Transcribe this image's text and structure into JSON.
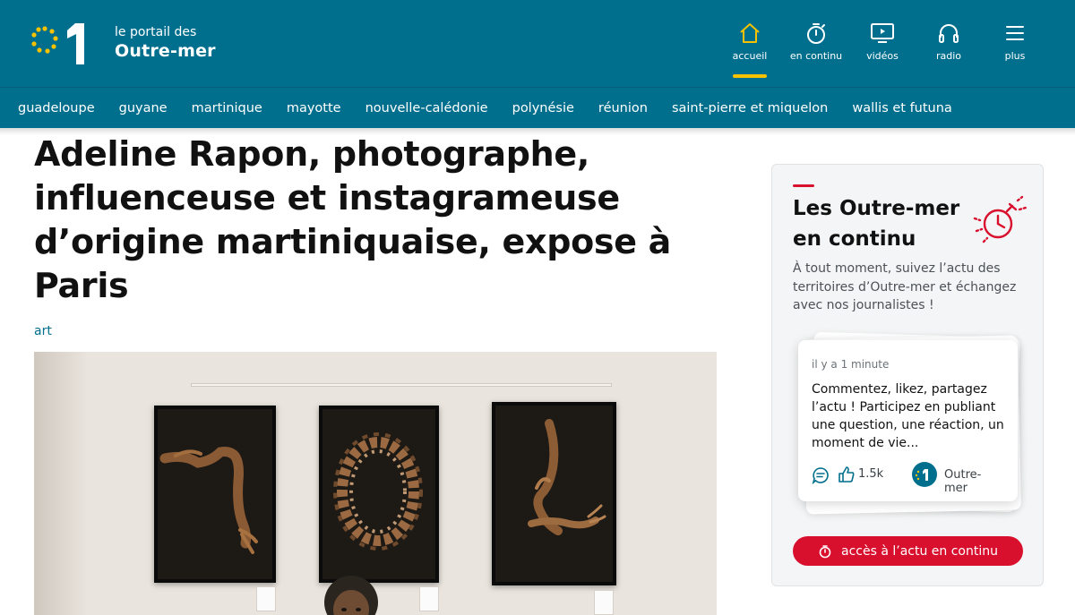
{
  "header": {
    "logo_line1": "le portail des",
    "logo_line2": "Outre-mer",
    "accent_color": "#f6c200",
    "background_color": "#006f8e",
    "nav": [
      {
        "label": "accueil",
        "icon": "home-icon",
        "active": true
      },
      {
        "label": "en continu",
        "icon": "stopwatch-icon",
        "active": false
      },
      {
        "label": "vidéos",
        "icon": "tv-icon",
        "active": false
      },
      {
        "label": "radio",
        "icon": "headphones-icon",
        "active": false
      },
      {
        "label": "plus",
        "icon": "menu-icon",
        "active": false
      }
    ]
  },
  "regions": [
    "guadeloupe",
    "guyane",
    "martinique",
    "mayotte",
    "nouvelle-calédonie",
    "polynésie",
    "réunion",
    "saint-pierre et miquelon",
    "wallis et futuna"
  ],
  "article": {
    "title": "Adeline Rapon, photographe, influenceuse et instagrameuse d’origine martiniquaise, expose à Paris",
    "tag": "art"
  },
  "sidebar": {
    "title": "Les Outre-mer en continu",
    "description": "À tout moment, suivez l’actu des territoires d’Outre-mer et échangez avec nos journalistes !",
    "card": {
      "time": "il y a 1 minute",
      "text": "Commentez, likez, partagez l’actu ! Participez en publiant une question, une réaction, un moment de vie...",
      "likes": "1.5k",
      "source": "Outre-mer"
    },
    "cta_label": "accès à l’actu en continu",
    "cta_color": "#d80f2d"
  }
}
